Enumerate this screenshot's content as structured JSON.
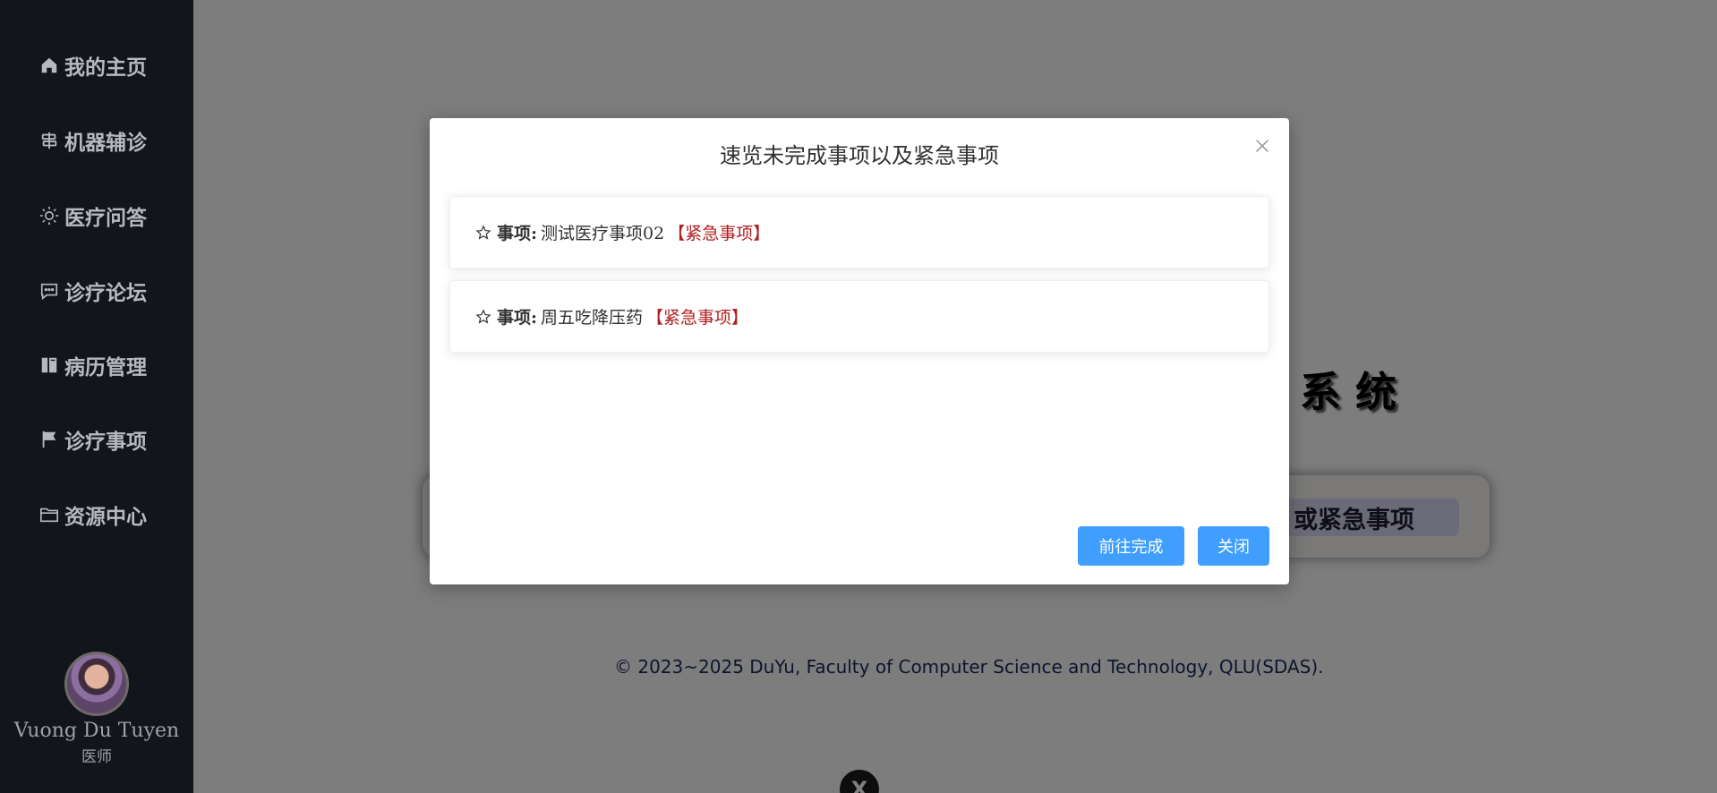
{
  "sidebar": {
    "items": [
      {
        "label": "我的主页",
        "icon": "home-icon"
      },
      {
        "label": "机器辅诊",
        "icon": "signpost-icon"
      },
      {
        "label": "医疗问答",
        "icon": "sun-icon"
      },
      {
        "label": "诊疗论坛",
        "icon": "chat-icon"
      },
      {
        "label": "病历管理",
        "icon": "book-icon"
      },
      {
        "label": "诊疗事项",
        "icon": "flag-icon"
      },
      {
        "label": "资源中心",
        "icon": "folder-icon"
      }
    ],
    "user": {
      "name": "Vuong Du Tuyen",
      "role": "医师"
    }
  },
  "main": {
    "hero_title_partial": "系统",
    "notice_button_partial": "或紧急事项",
    "copyright": "© 2023~2025 DuYu, Faculty of Computer Science and Technology, QLU(SDAS).",
    "bottom_badge": "X"
  },
  "modal": {
    "title": "速览未完成事项以及紧急事项",
    "tasks": [
      {
        "label": "事项:",
        "name": "测试医疗事项02",
        "tag": "【紧急事项】"
      },
      {
        "label": "事项:",
        "name": "周五吃降压药",
        "tag": "【紧急事项】"
      }
    ],
    "buttons": {
      "go": "前往完成",
      "close": "关闭"
    }
  },
  "colors": {
    "sidebar_bg": "#12151b",
    "primary_button": "#409eff",
    "urgent_tag": "#b01e1e",
    "overlay": "rgba(0,0,0,0.5)"
  }
}
